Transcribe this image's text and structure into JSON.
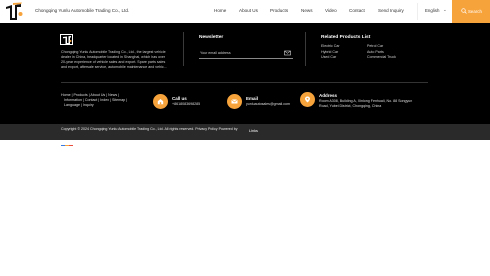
{
  "header": {
    "company_name": "Chongqing Yunlu Automobile Trading Co., Ltd.",
    "nav": [
      "Home",
      "About Us",
      "Products",
      "News",
      "Video",
      "Contact",
      "Send Inquiry"
    ],
    "language": "English",
    "search_label": "Search"
  },
  "footer": {
    "description": "Chongqing Yunlu Automobile Trading Co., Ltd., the largest vehicle dealer in China, headquarter located in Shanghai, which has over 20-year experience of vehicle sales and export. Spare parts sales and export, aftersale service, automobile maintenance and vehic...",
    "newsletter": {
      "title": "Newsletter",
      "placeholder": "Your email address"
    },
    "related": {
      "title": "Related Products List",
      "col1": [
        "Electric Car",
        "Hybrid Car",
        "Used Car"
      ],
      "col2": [
        "Petrol Car",
        "Auto Parts",
        "Commercial Truck"
      ]
    },
    "quick_links_line1": "Home  |  Products  |  About Us  |  News  |",
    "quick_links_line2": "Information  |  Contact  |  Index  |  Sitemap  |",
    "quick_links_line3": "Language  |  Inquiry",
    "call": {
      "title": "Call us",
      "value": "+8618083698285"
    },
    "email": {
      "title": "Email",
      "value": "yunluautosales@gmail.com"
    },
    "address": {
      "title": "Address",
      "line1": "Room A308, Building A, Xinlong Fenhuali, No. 88 Songyun",
      "line2": "Road, Yubei District, Chongqing, China"
    }
  },
  "copyright": {
    "text": "Copyright © 2024 Chongqing Yunlu Automobile Trading Co., Ltd. All rights reserved. Privacy Policy Powered by",
    "links_label": "Links"
  },
  "colors": {
    "accent": "#f7a33c",
    "footer_bg": "#000000",
    "copybar_bg": "#2a2a2a"
  },
  "icons": [
    "logo",
    "chevron-down-icon",
    "search-icon",
    "mail-icon",
    "home-icon",
    "email-icon",
    "location-icon"
  ]
}
